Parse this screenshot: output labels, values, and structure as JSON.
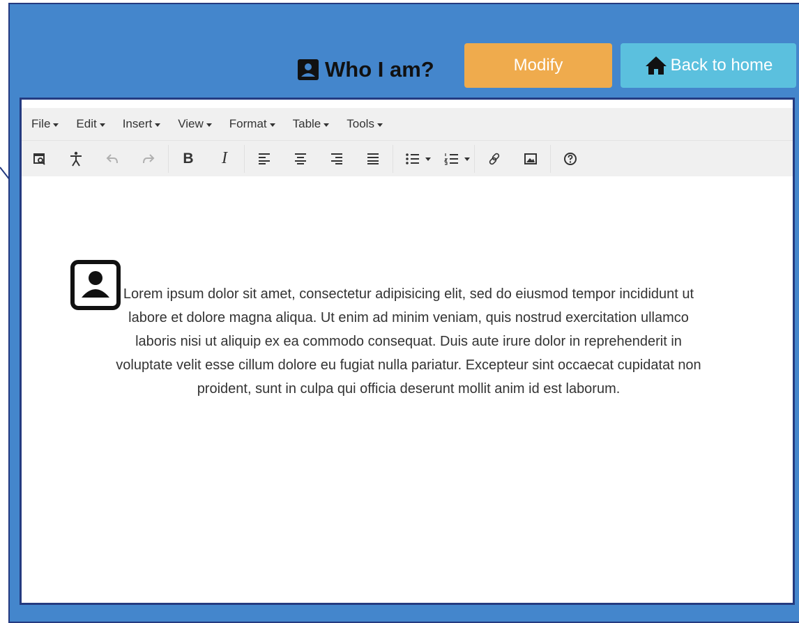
{
  "header": {
    "title": "Who I am?",
    "title_icon": "portrait-icon",
    "modify_label": "Modify",
    "back_home_label": "Back to home",
    "home_icon": "home-icon"
  },
  "colors": {
    "header_bg": "#4486cc",
    "frame_border": "#243a80",
    "modify_bg": "#efab4d",
    "home_bg": "#5bc0de",
    "toolbar_bg": "#f0f0f0"
  },
  "editor": {
    "menu": [
      {
        "label": "File"
      },
      {
        "label": "Edit"
      },
      {
        "label": "Insert"
      },
      {
        "label": "View"
      },
      {
        "label": "Format"
      },
      {
        "label": "Table"
      },
      {
        "label": "Tools"
      }
    ],
    "toolbar": {
      "bold_label": "B",
      "italic_label": "I",
      "buttons": [
        "preview-icon",
        "accessibility-icon",
        "undo-icon",
        "redo-icon",
        "bold-icon",
        "italic-icon",
        "align-left-icon",
        "align-center-icon",
        "align-right-icon",
        "align-justify-icon",
        "bullet-list-icon",
        "numbered-list-icon",
        "link-icon",
        "image-icon",
        "help-icon"
      ]
    },
    "content": {
      "icon": "portrait-icon",
      "paragraph": "Lorem ipsum dolor sit amet, consectetur adipisicing elit, sed do eiusmod tempor incididunt ut labore et dolore magna aliqua. Ut enim ad minim veniam, quis nostrud exercitation ullamco laboris nisi ut aliquip ex ea commodo consequat. Duis aute irure dolor in reprehenderit in voluptate velit esse cillum dolore eu fugiat nulla pariatur. Excepteur sint occaecat cupidatat non proident, sunt in culpa qui officia deserunt mollit anim id est laborum."
    }
  }
}
